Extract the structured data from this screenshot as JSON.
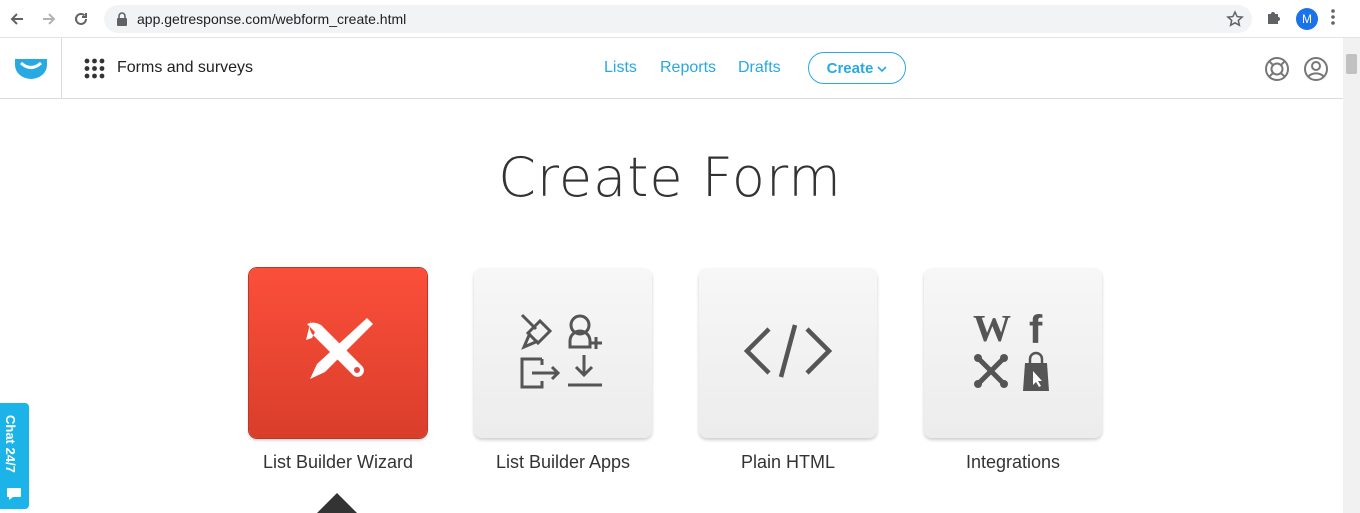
{
  "browser": {
    "url": "app.getresponse.com/webform_create.html",
    "profile_initial": "M"
  },
  "header": {
    "section_title": "Forms and surveys",
    "nav": [
      "Lists",
      "Reports",
      "Drafts"
    ],
    "create_label": "Create"
  },
  "main": {
    "title": "Create Form",
    "tiles": [
      {
        "label": "List Builder Wizard",
        "icon": "tools-icon",
        "active": true
      },
      {
        "label": "List Builder Apps",
        "icon": "apps-icon",
        "active": false
      },
      {
        "label": "Plain HTML",
        "icon": "code-icon",
        "active": false
      },
      {
        "label": "Integrations",
        "icon": "integrations-icon",
        "active": false
      }
    ]
  },
  "chat": {
    "label": "Chat 24/7"
  },
  "colors": {
    "accent": "#27a9e1",
    "active_tile": "#ef4a36",
    "chat": "#1cb4e8"
  }
}
